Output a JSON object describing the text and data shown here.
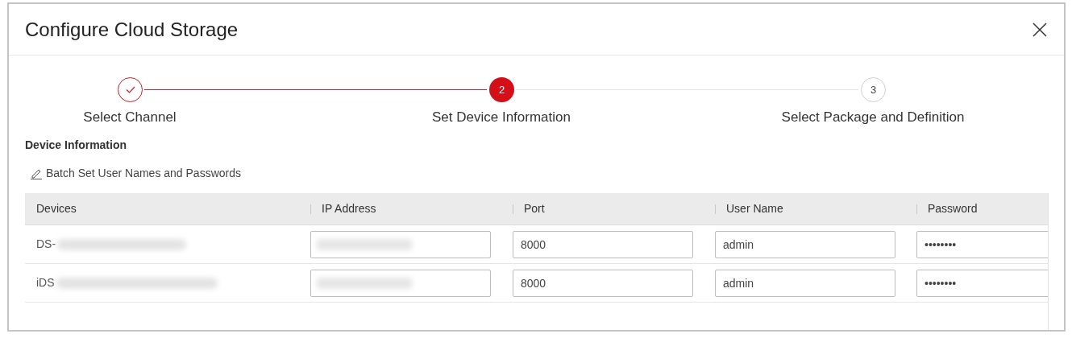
{
  "dialog": {
    "title": "Configure Cloud Storage"
  },
  "steps": [
    {
      "label": "Select Channel",
      "completed": true,
      "selected": false
    },
    {
      "number": "2",
      "label": "Set Device Information",
      "completed": false,
      "selected": true
    },
    {
      "number": "3",
      "label": "Select Package and Definition",
      "completed": false,
      "selected": false
    }
  ],
  "section_title": "Device Information",
  "batch_link": "Batch Set User Names and Passwords",
  "table": {
    "columns": [
      "Devices",
      "IP Address",
      "Port",
      "User Name",
      "Password"
    ],
    "rows": [
      {
        "device": "DS-",
        "port": "8000",
        "user_name": "admin",
        "password": "••••••••"
      },
      {
        "device": "iDS",
        "port": "8000",
        "user_name": "admin",
        "password": "••••••••"
      }
    ]
  }
}
